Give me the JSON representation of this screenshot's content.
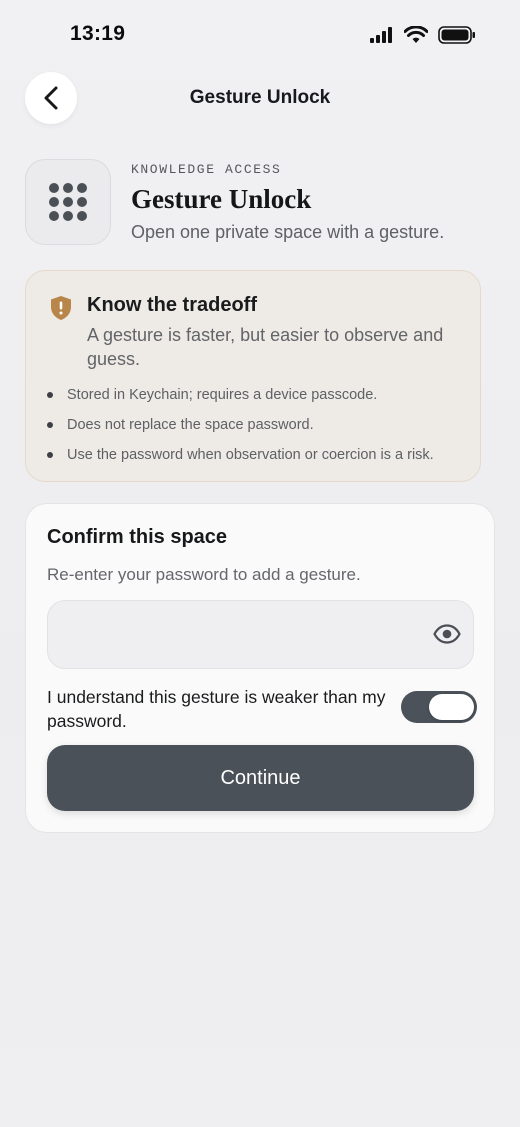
{
  "status_bar": {
    "time": "13:19"
  },
  "nav": {
    "title": "Gesture Unlock"
  },
  "hero": {
    "eyebrow": "KNOWLEDGE ACCESS",
    "title": "Gesture Unlock",
    "subtitle": "Open one private space with a gesture."
  },
  "tradeoff": {
    "title": "Know the tradeoff",
    "description": "A gesture is faster, but easier to observe and guess.",
    "bullets": [
      "Stored in Keychain; requires a device passcode.",
      "Does not replace the space password.",
      "Use the password when observation or coercion is a risk."
    ]
  },
  "confirm": {
    "title": "Confirm this space",
    "subtitle": "Re-enter your password to add a gesture.",
    "password_value": "",
    "ack_label": "I understand this gesture is weaker than my password.",
    "toggle_on": true,
    "continue_label": "Continue"
  },
  "colors": {
    "accent_dark": "#4b5159",
    "shield": "#b8864a",
    "card_warm": "#eeebe6"
  }
}
